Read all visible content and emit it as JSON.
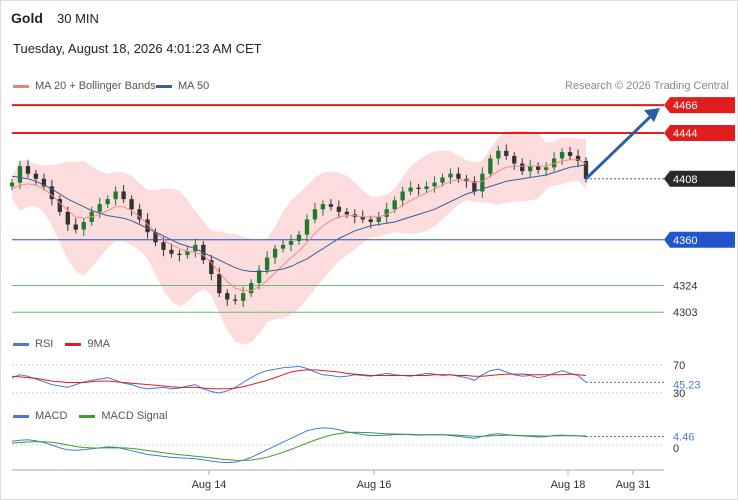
{
  "header": {
    "symbol": "Gold",
    "timeframe": "30 MIN",
    "datetime": "Tuesday, August 18, 2026 4:01:23 AM CET"
  },
  "legend": [
    {
      "label": "MA 20 + Bollinger Bands",
      "color": "#f27c7c"
    },
    {
      "label": "MA 50",
      "color": "#3b5f9a"
    }
  ],
  "credit": "Research © 2026 Trading Central",
  "colors": {
    "up": "#1e7a2e",
    "down": "#333333",
    "band": "#fbd6d6",
    "resistance": "#e01e1e",
    "support": "#2255cc",
    "target": "#6dbb6d",
    "arrow": "#2d5fa8"
  },
  "chart_data": [
    {
      "type": "line",
      "title": "Gold",
      "subtitle": "30 MIN",
      "ylim": [
        4290,
        4480
      ],
      "x_ticks": [
        "Aug 14",
        "Aug 16",
        "Aug 18",
        "Aug 31"
      ],
      "last_price": 4408,
      "levels": [
        {
          "value": 4466,
          "label": "4466",
          "kind": "resistance"
        },
        {
          "value": 4444,
          "label": "4444",
          "kind": "resistance"
        },
        {
          "value": 4408,
          "label": "4408",
          "kind": "price"
        },
        {
          "value": 4360,
          "label": "4360",
          "kind": "support"
        },
        {
          "value": 4324,
          "label": "4324",
          "kind": "target"
        },
        {
          "value": 4303,
          "label": "4303",
          "kind": "target"
        }
      ],
      "series": [
        {
          "name": "Gold",
          "values": [
            4405,
            4418,
            4412,
            4408,
            4402,
            4392,
            4382,
            4372,
            4368,
            4374,
            4382,
            4388,
            4392,
            4398,
            4392,
            4384,
            4376,
            4366,
            4358,
            4352,
            4349,
            4348,
            4351,
            4356,
            4344,
            4333,
            4318,
            4313,
            4312,
            4318,
            4326,
            4336,
            4346,
            4353,
            4356,
            4359,
            4364,
            4376,
            4384,
            4388,
            4386,
            4382,
            4380,
            4378,
            4376,
            4374,
            4378,
            4384,
            4391,
            4398,
            4401,
            4400,
            4402,
            4405,
            4409,
            4412,
            4408,
            4406,
            4398,
            4412,
            4424,
            4430,
            4426,
            4420,
            4414,
            4418,
            4415,
            4417,
            4424,
            4429,
            4426,
            4422,
            4408
          ]
        },
        {
          "name": "MA 20",
          "values": [
            4400,
            4403,
            4404,
            4403,
            4400,
            4395,
            4389,
            4383,
            4378,
            4377,
            4378,
            4380,
            4383,
            4386,
            4386,
            4383,
            4378,
            4372,
            4366,
            4360,
            4356,
            4353,
            4351,
            4350,
            4348,
            4342,
            4334,
            4327,
            4322,
            4320,
            4320,
            4323,
            4328,
            4334,
            4340,
            4346,
            4351,
            4358,
            4365,
            4371,
            4375,
            4378,
            4379,
            4379,
            4378,
            4378,
            4378,
            4380,
            4383,
            4387,
            4391,
            4394,
            4397,
            4400,
            4403,
            4406,
            4407,
            4407,
            4405,
            4406,
            4410,
            4414,
            4417,
            4418,
            4418,
            4418,
            4418,
            4418,
            4420,
            4422,
            4423,
            4423,
            4420
          ]
        },
        {
          "name": "MA 50",
          "values": [
            4410,
            4409,
            4408,
            4406,
            4403,
            4400,
            4396,
            4392,
            4389,
            4386,
            4383,
            4381,
            4379,
            4378,
            4377,
            4375,
            4372,
            4369,
            4366,
            4363,
            4360,
            4357,
            4355,
            4353,
            4350,
            4347,
            4344,
            4341,
            4338,
            4336,
            4335,
            4335,
            4335,
            4336,
            4337,
            4339,
            4342,
            4345,
            4349,
            4353,
            4357,
            4361,
            4364,
            4367,
            4369,
            4371,
            4372,
            4373,
            4374,
            4376,
            4378,
            4380,
            4382,
            4384,
            4387,
            4390,
            4393,
            4396,
            4398,
            4400,
            4402,
            4404,
            4406,
            4407,
            4408,
            4409,
            4410,
            4411,
            4413,
            4415,
            4417,
            4418,
            4419
          ]
        }
      ]
    },
    {
      "type": "line",
      "title": "RSI",
      "ylim": [
        25,
        75
      ],
      "ticks": [
        70,
        30
      ],
      "last_value": 45.23,
      "series": [
        {
          "name": "RSI",
          "values": [
            52,
            56,
            54,
            50,
            46,
            42,
            40,
            38,
            42,
            46,
            48,
            50,
            52,
            48,
            44,
            42,
            38,
            36,
            37,
            38,
            36,
            37,
            40,
            42,
            36,
            32,
            30,
            33,
            38,
            45,
            52,
            58,
            62,
            64,
            66,
            67,
            68,
            65,
            60,
            56,
            55,
            53,
            54,
            56,
            55,
            54,
            56,
            58,
            56,
            55,
            54,
            56,
            58,
            57,
            55,
            56,
            54,
            52,
            48,
            56,
            62,
            64,
            60,
            56,
            54,
            55,
            52,
            54,
            58,
            62,
            58,
            55,
            45.23
          ]
        },
        {
          "name": "9MA",
          "values": [
            54,
            53,
            52,
            51,
            49,
            47,
            46,
            45,
            45,
            45,
            46,
            47,
            47,
            46,
            45,
            44,
            43,
            42,
            41,
            40,
            39,
            38,
            38,
            38,
            37,
            36,
            36,
            36,
            37,
            39,
            42,
            45,
            48,
            52,
            56,
            60,
            62,
            63,
            63,
            62,
            61,
            60,
            58,
            57,
            56,
            55,
            55,
            55,
            55,
            55,
            55,
            55,
            55,
            56,
            56,
            56,
            55,
            55,
            54,
            54,
            55,
            56,
            57,
            57,
            57,
            56,
            56,
            56,
            56,
            56,
            57,
            56,
            55
          ]
        }
      ]
    },
    {
      "type": "line",
      "title": "MACD",
      "ylim": [
        -12,
        12
      ],
      "ticks": [
        0
      ],
      "last_value": 4.46,
      "series": [
        {
          "name": "MACD",
          "values": [
            2,
            2.5,
            2.8,
            2.2,
            1.2,
            0,
            -1.5,
            -2.5,
            -2.8,
            -2.5,
            -2,
            -1.5,
            -1,
            -1.2,
            -2,
            -3,
            -4,
            -5,
            -5.5,
            -6,
            -6.5,
            -6.8,
            -7,
            -7.2,
            -7.8,
            -8.5,
            -9,
            -9.2,
            -9,
            -8,
            -6.5,
            -4.5,
            -2.5,
            -0.5,
            1.5,
            3.5,
            5.5,
            7.5,
            8.5,
            9,
            8.8,
            8,
            7,
            6.2,
            5.5,
            5,
            5,
            5.2,
            5.5,
            5.6,
            5.4,
            5.2,
            5.3,
            5.5,
            5.4,
            5,
            4.5,
            4,
            3.5,
            4.5,
            5.5,
            6,
            5.5,
            5,
            4.8,
            4.5,
            4.2,
            4.4,
            5,
            5.2,
            5,
            4.8,
            4.46
          ]
        },
        {
          "name": "MACD Signal",
          "values": [
            1,
            1.3,
            1.6,
            1.8,
            1.7,
            1.4,
            0.8,
            0,
            -0.8,
            -1.3,
            -1.5,
            -1.6,
            -1.5,
            -1.4,
            -1.5,
            -1.8,
            -2.3,
            -2.9,
            -3.5,
            -4.1,
            -4.6,
            -5.1,
            -5.5,
            -5.9,
            -6.3,
            -6.8,
            -7.3,
            -7.7,
            -8,
            -8.1,
            -7.9,
            -7.3,
            -6.4,
            -5.2,
            -3.8,
            -2.3,
            -0.7,
            1,
            2.6,
            4,
            5.2,
            6,
            6.5,
            6.7,
            6.6,
            6.4,
            6.1,
            5.9,
            5.8,
            5.7,
            5.6,
            5.5,
            5.4,
            5.4,
            5.4,
            5.3,
            5.1,
            4.9,
            4.6,
            4.6,
            4.8,
            5,
            5.1,
            5.1,
            5,
            4.9,
            4.8,
            4.7,
            4.8,
            4.9,
            4.9,
            4.9,
            4.8
          ]
        }
      ]
    }
  ]
}
